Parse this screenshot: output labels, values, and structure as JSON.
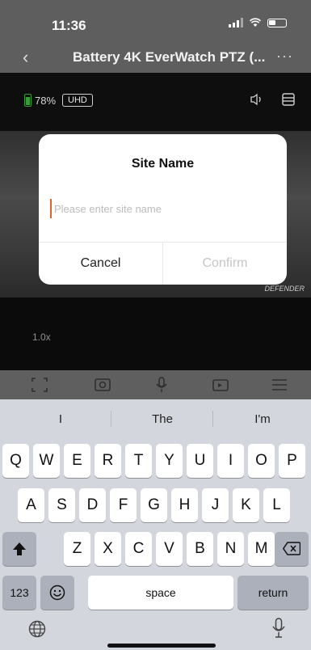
{
  "status_bar": {
    "time": "11:36"
  },
  "nav": {
    "title": "Battery 4K EverWatch PTZ (...",
    "more": "···"
  },
  "camera": {
    "battery_percent": "78%",
    "quality_badge": "UHD",
    "zoom": "1.0x",
    "watermark": "DEFENDER"
  },
  "dialog": {
    "title": "Site Name",
    "placeholder": "Please enter site name",
    "value": "",
    "cancel": "Cancel",
    "confirm": "Confirm"
  },
  "keyboard": {
    "suggestions": [
      "I",
      "The",
      "I'm"
    ],
    "row1": [
      "Q",
      "W",
      "E",
      "R",
      "T",
      "Y",
      "U",
      "I",
      "O",
      "P"
    ],
    "row2": [
      "A",
      "S",
      "D",
      "F",
      "G",
      "H",
      "J",
      "K",
      "L"
    ],
    "row3": [
      "Z",
      "X",
      "C",
      "V",
      "B",
      "N",
      "M"
    ],
    "numbers_key": "123",
    "space_key": "space",
    "return_key": "return"
  }
}
